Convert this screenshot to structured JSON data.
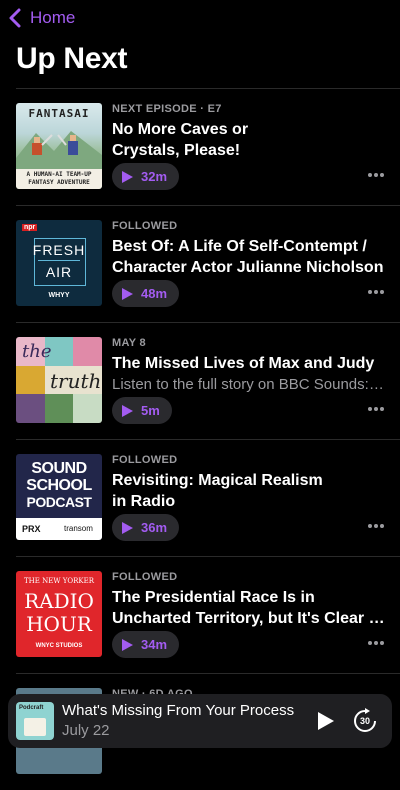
{
  "nav": {
    "back_label": "Home"
  },
  "page": {
    "title": "Up Next"
  },
  "accent": "#a35cf1",
  "episodes": [
    {
      "meta": "NEXT EPISODE · E7",
      "title_lines": [
        "No More Caves or",
        "Crystals, Please!"
      ],
      "subtitle": "",
      "duration": "32m",
      "art": {
        "line1": "FANTASAI",
        "line2": "A HUMAN-AI TEAM-UP",
        "line3": "FANTASY ADVENTURE"
      }
    },
    {
      "meta": "FOLLOWED",
      "title_lines": [
        "Best Of: A Life Of Self-Contempt /",
        "Character Actor Julianne Nicholson"
      ],
      "subtitle": "",
      "duration": "48m",
      "art": {
        "line1": "FRESH",
        "line2": "AIR",
        "line3": "WHYY",
        "line4": "npr"
      }
    },
    {
      "meta": "MAY 8",
      "title_lines": [
        "The Missed Lives of Max and Judy"
      ],
      "subtitle": "Listen to the full story on BBC Sounds: bbc.in/",
      "duration": "5m",
      "art": {
        "line1": "the",
        "line2": "truth"
      }
    },
    {
      "meta": "FOLLOWED",
      "title_lines": [
        "Revisiting: Magical Realism",
        "in Radio"
      ],
      "subtitle": "",
      "duration": "36m",
      "art": {
        "line1": "SOUND",
        "line2": "SCHOOL",
        "line3": "PODCAST",
        "line4": "PRX",
        "line5": "transom"
      }
    },
    {
      "meta": "FOLLOWED",
      "title_lines": [
        "The Presidential Race Is in",
        "Uncharted Territory, but It's Clear What"
      ],
      "subtitle": "",
      "duration": "34m",
      "art": {
        "line1": "THE NEW YORKER",
        "line2": "RADIO",
        "line3": "HOUR",
        "line4": "WNYC STUDIOS"
      }
    },
    {
      "meta": "NEW · 6D AGO",
      "title_lines": [
        ""
      ],
      "subtitle": "",
      "duration": "",
      "art": {}
    }
  ],
  "mini_player": {
    "title": "What's Missing From Your Process",
    "date": "July 22",
    "art_label": "Podcraft",
    "skip_label": "30"
  }
}
